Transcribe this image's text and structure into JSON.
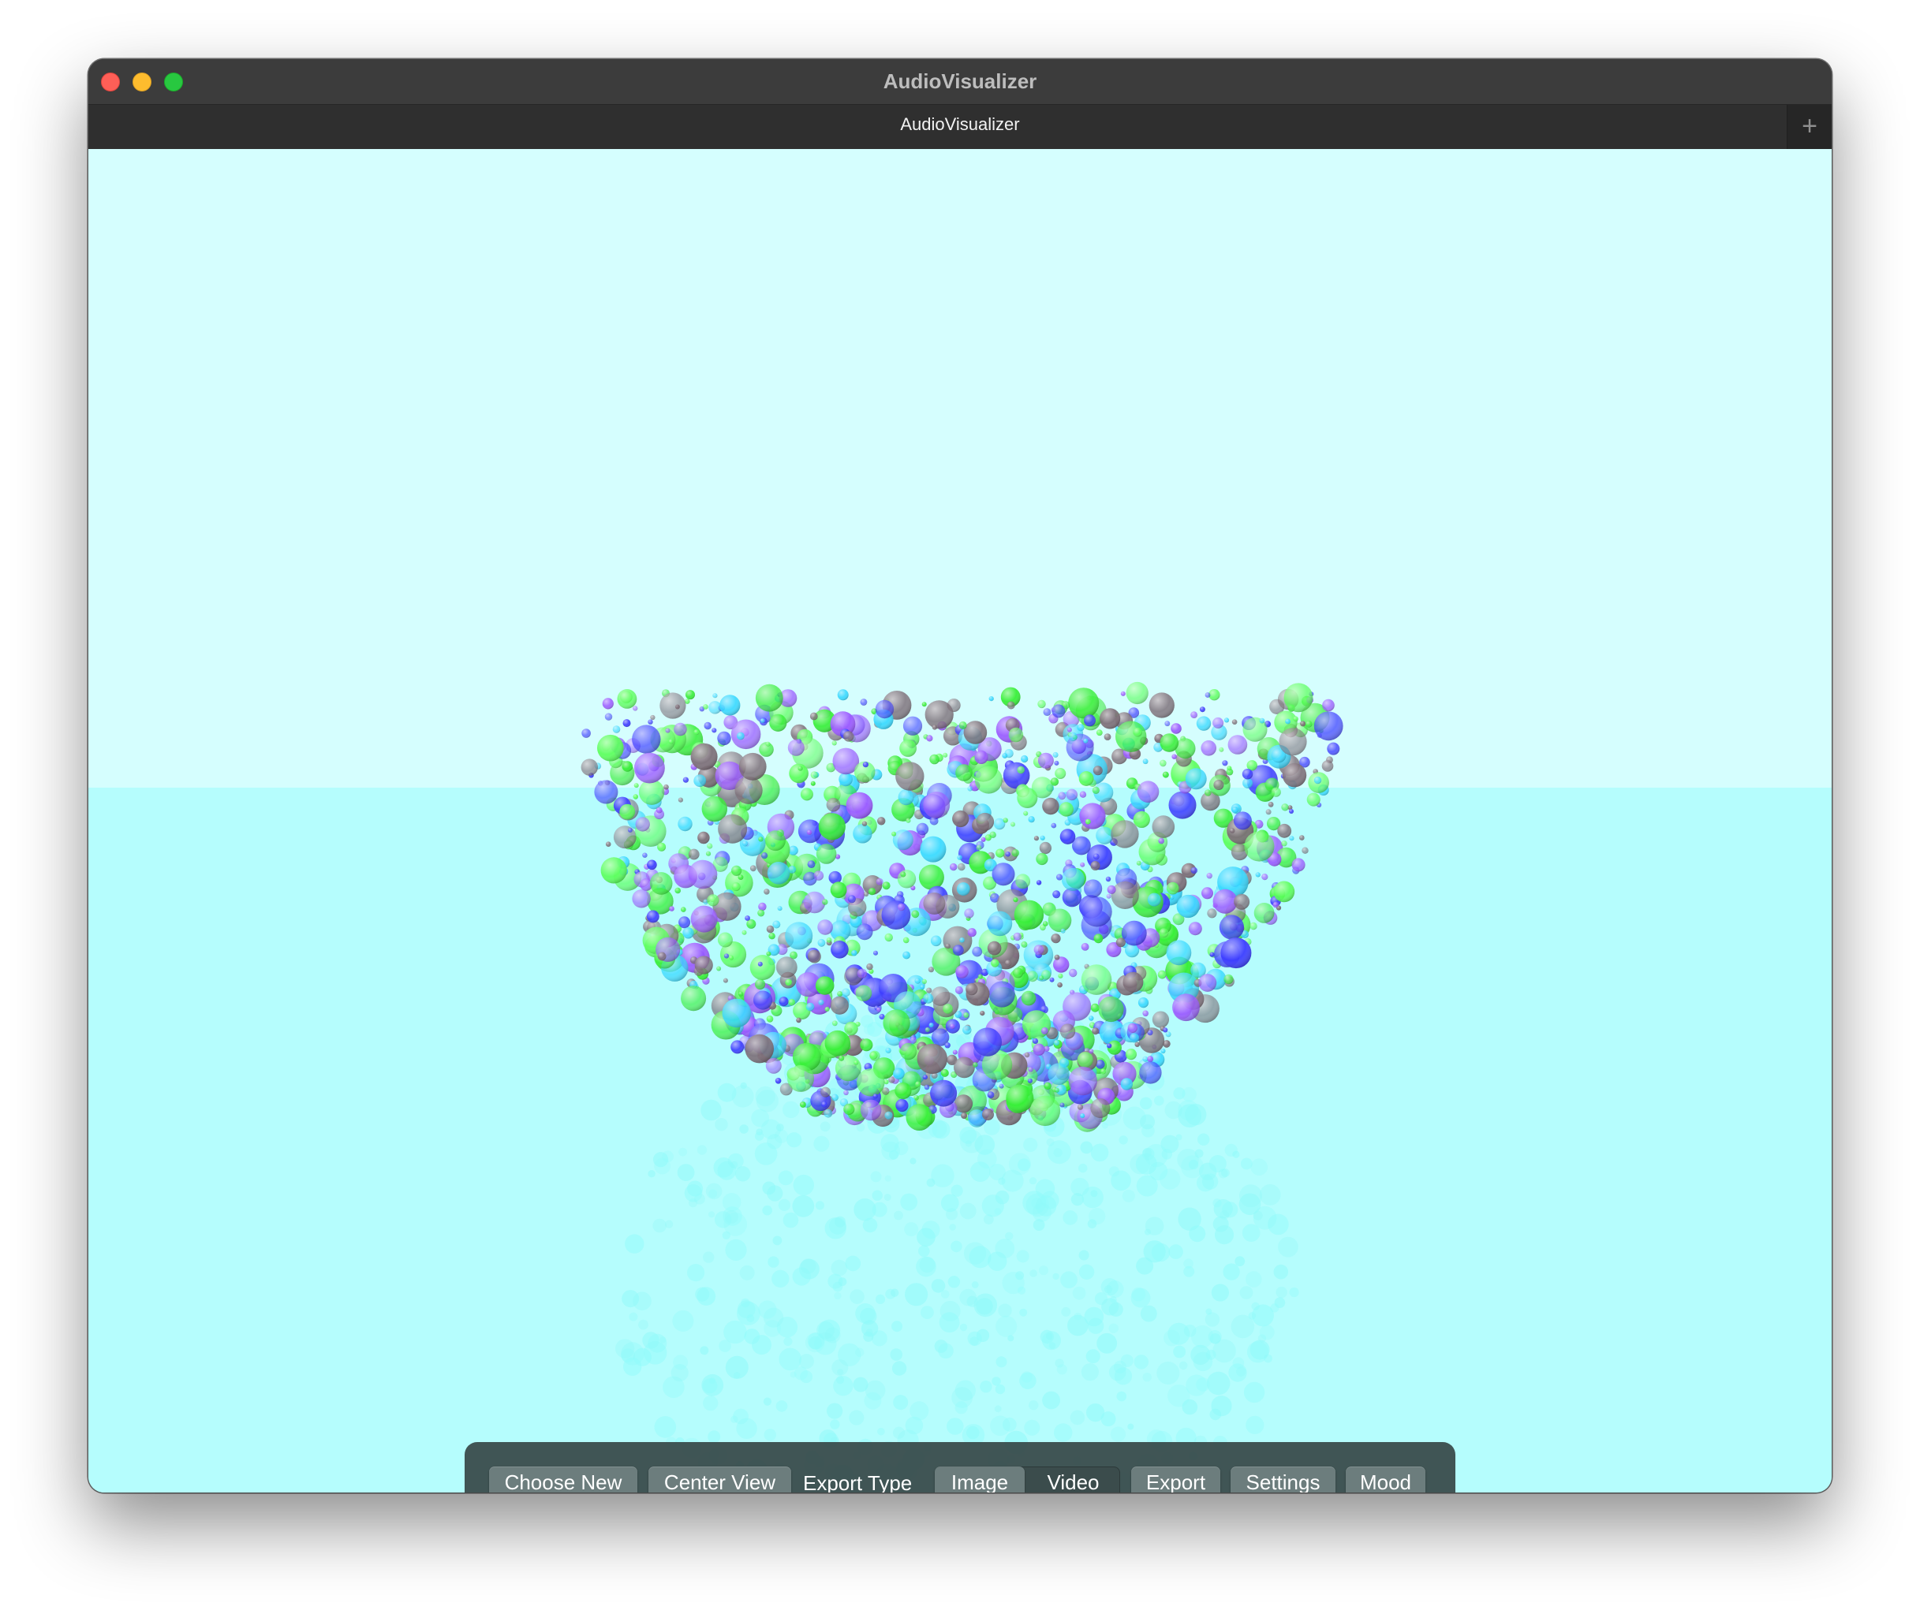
{
  "window": {
    "title": "AudioVisualizer",
    "tab_label": "AudioVisualizer",
    "add_tab_symbol": "+",
    "traffic_lights": [
      "close",
      "minimize",
      "zoom"
    ]
  },
  "scene": {
    "background_color": "#d5fefe",
    "floor_color": "#b5fdfd",
    "particle_colors": [
      "#3b3bff",
      "#35ef35",
      "#35d8ff",
      "#7a6a74",
      "#9a59ff",
      "#59ff59"
    ],
    "reflection_color": "#8ffafa"
  },
  "toolbar": {
    "choose_new": "Choose New",
    "center_view": "Center View",
    "export_type_label": "Export Type",
    "export_type_options": [
      "Image",
      "Video"
    ],
    "export_type_selected": "Image",
    "export": "Export",
    "settings": "Settings",
    "mood": "Mood"
  }
}
